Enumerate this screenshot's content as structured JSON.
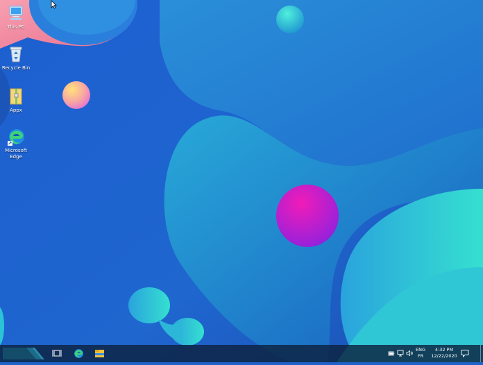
{
  "desktop": {
    "icons": [
      {
        "label": "This PC",
        "icon": "computer-icon"
      },
      {
        "label": "Recycle Bin",
        "icon": "recycle-bin-icon"
      },
      {
        "label": "Appx",
        "icon": "folder-zip-icon"
      },
      {
        "label": "Microsoft\nEdge",
        "icon": "edge-icon"
      }
    ]
  },
  "taskbar": {
    "start": "start-button",
    "pinned": [
      {
        "name": "task-view-button",
        "icon": "task-view-icon"
      },
      {
        "name": "edge-taskbar-button",
        "icon": "edge-icon"
      },
      {
        "name": "file-explorer-button",
        "icon": "folder-icon"
      }
    ],
    "tray": {
      "icons": [
        "battery-icon",
        "network-icon",
        "volume-icon"
      ],
      "language_line1": "ENG",
      "language_line2": "FR",
      "time": "4:32 PM",
      "date": "12/22/2020",
      "notification_icon": "notification-icon"
    }
  },
  "colors": {
    "wallpaper_base": "#1f62c9",
    "taskbar": "#0c2240",
    "accent_teal": "#2fd6d0",
    "accent_magenta": "#c21fd0"
  }
}
